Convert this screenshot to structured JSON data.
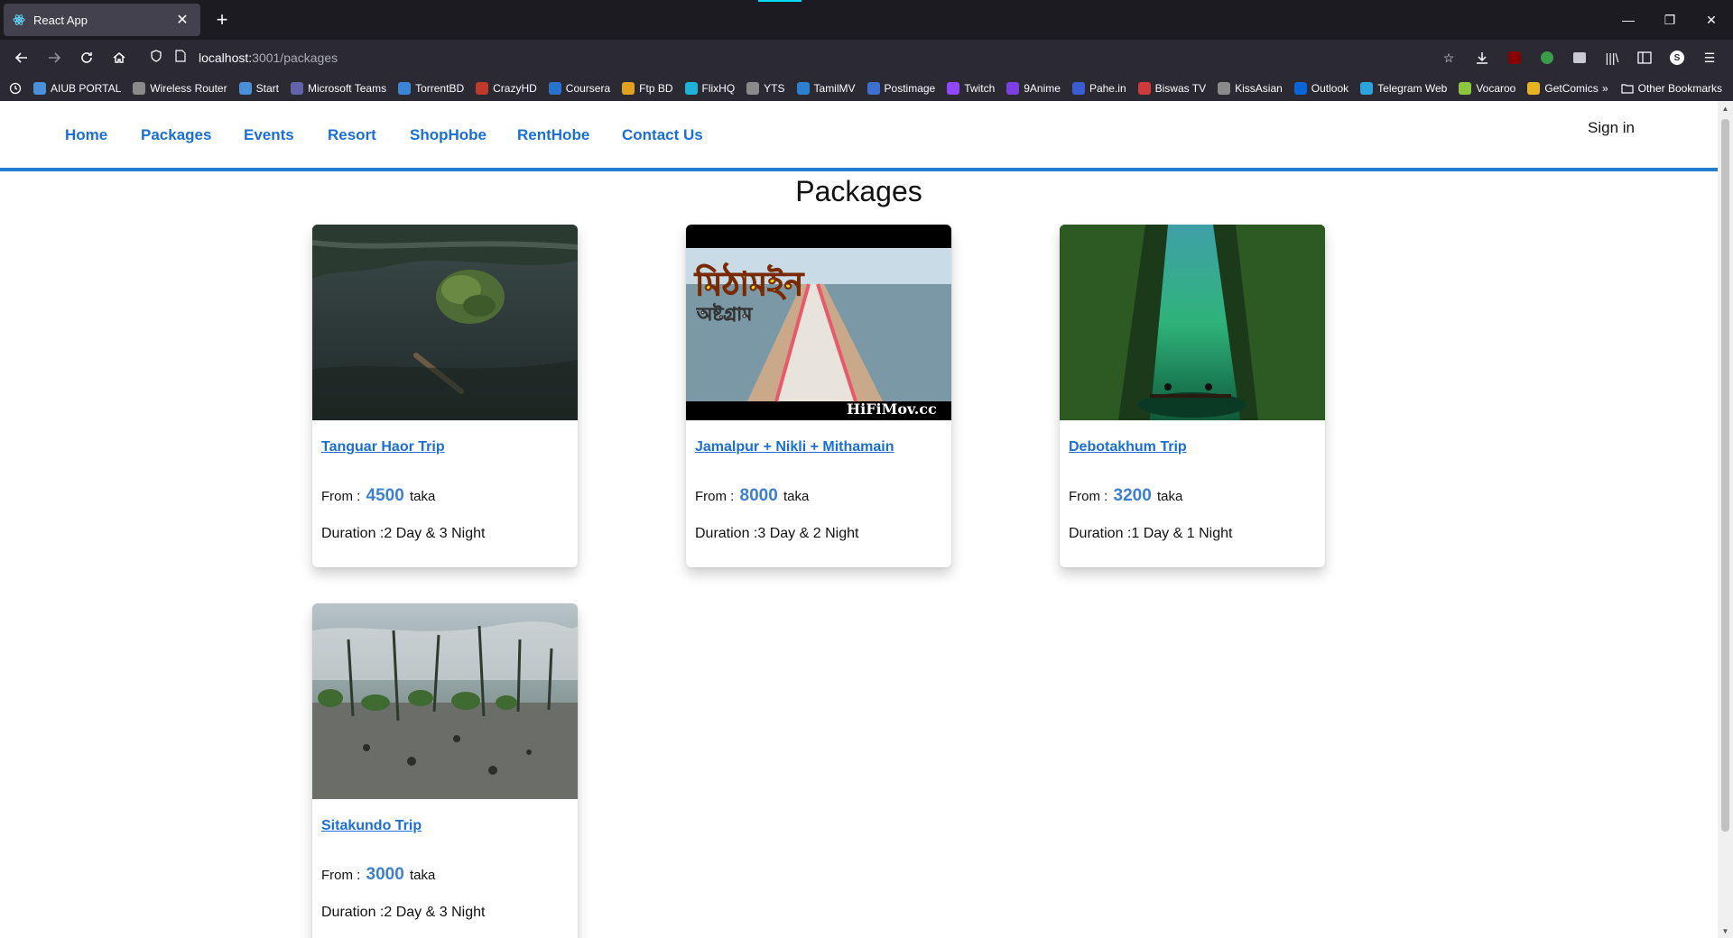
{
  "browser": {
    "tab_title": "React App",
    "url_host": "localhost:",
    "url_path": "3001/packages",
    "bookmarks": [
      {
        "label": "AIUB PORTAL",
        "color": "#4a90d9"
      },
      {
        "label": "Wireless Router",
        "color": "#8a8a8a"
      },
      {
        "label": "Start",
        "color": "#4a90d9"
      },
      {
        "label": "Microsoft Teams",
        "color": "#6264a7"
      },
      {
        "label": "TorrentBD",
        "color": "#3a86d4"
      },
      {
        "label": "CrazyHD",
        "color": "#c0392b"
      },
      {
        "label": "Coursera",
        "color": "#2a73cc"
      },
      {
        "label": "Ftp BD",
        "color": "#e0a020"
      },
      {
        "label": "FlixHQ",
        "color": "#1fb1d8"
      },
      {
        "label": "YTS",
        "color": "#8a8a8a"
      },
      {
        "label": "TamilMV",
        "color": "#2d7fd1"
      },
      {
        "label": "Postimage",
        "color": "#3d6fd1"
      },
      {
        "label": "Twitch",
        "color": "#9146ff"
      },
      {
        "label": "9Anime",
        "color": "#7b3fe4"
      },
      {
        "label": "Pahe.in",
        "color": "#3a5ed1"
      },
      {
        "label": "Biswas TV",
        "color": "#d13a3a"
      },
      {
        "label": "KissAsian",
        "color": "#8a8a8a"
      },
      {
        "label": "Outlook",
        "color": "#0a64d6"
      },
      {
        "label": "Telegram Web",
        "color": "#2aa3df"
      },
      {
        "label": "Vocaroo",
        "color": "#8cc63f"
      },
      {
        "label": "GetComics",
        "color": "#e6b422"
      }
    ],
    "other_bookmarks": "Other Bookmarks"
  },
  "site": {
    "nav": [
      "Home",
      "Packages",
      "Events",
      "Resort",
      "ShopHobe",
      "RentHobe",
      "Contact Us"
    ],
    "signin": "Sign in",
    "title": "Packages",
    "from_label": "From :",
    "currency": "taka",
    "duration_label": "Duration :",
    "packages": [
      {
        "name": "Tanguar Haor Trip",
        "price": "4500",
        "duration": "2 Day & 3 Night",
        "image": "aerial-haor-boat"
      },
      {
        "name": "Jamalpur + Nikli + Mithamain",
        "price": "8000",
        "duration": "3 Day & 2 Night",
        "image": "mithamain-road",
        "image_text_bn": "মিঠামইন",
        "image_text_bn2": "অষ্টগ্রাম",
        "image_watermark": "HiFiMov.cc"
      },
      {
        "name": "Debotakhum Trip",
        "price": "3200",
        "duration": "1 Day & 1 Night",
        "image": "green-canyon-boat"
      },
      {
        "name": "Sitakundo Trip",
        "price": "3000",
        "duration": "2 Day & 3 Night",
        "image": "mangrove-beach"
      }
    ]
  }
}
